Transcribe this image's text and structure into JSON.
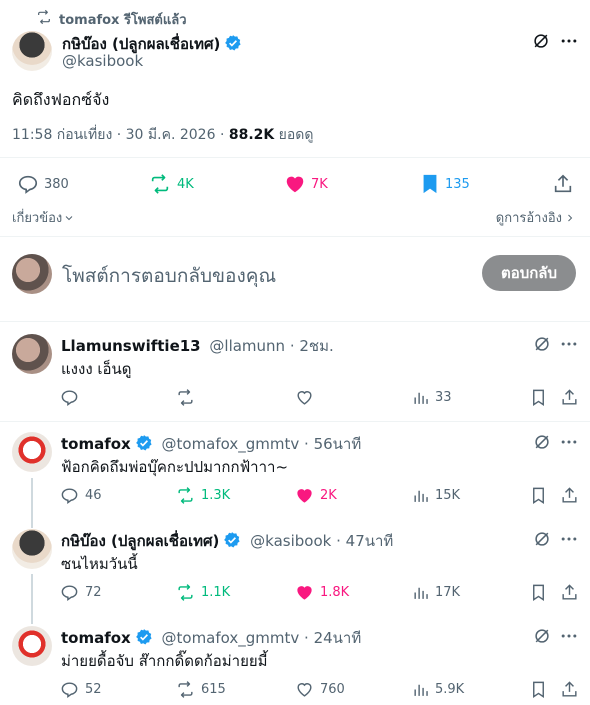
{
  "repost_banner": {
    "text": "tomafox รีโพสต์แล้ว"
  },
  "main_post": {
    "author_name": "กษิบ๊อง (ปลูกผลเชื่อเทศ)",
    "handle": "@kasibook",
    "text": "คิดถึงฟอกซ์จัง",
    "timestamp": "11:58 ก่อนเที่ยง · 30 มี.ค. 2026 · ",
    "views_value": "88.2K",
    "views_label": " ยอดดู",
    "stats": {
      "replies": "380",
      "reposts": "4K",
      "likes": "7K",
      "bookmarks": "135"
    },
    "related_label": "เกี่ยวข้อง",
    "quotes_label": "ดูการอ้างอิง"
  },
  "compose": {
    "placeholder": "โพสต์การตอบกลับของคุณ",
    "reply_button": "ตอบกลับ"
  },
  "replies": [
    {
      "name": "Llamunswiftie13",
      "handle": "@llamunn",
      "time": " · 2ชม.",
      "text": "แงงง เอ็นดู",
      "replies": "",
      "reposts": "",
      "likes": "",
      "views": "33"
    },
    {
      "name": "tomafox",
      "handle": "@tomafox_gmmtv",
      "time": " · 56นาที",
      "text": "ฟ้อกคิดถึมพ่อบุ๊คกะปปมากกฟ้าาา~",
      "replies": "46",
      "reposts": "1.3K",
      "likes": "2K",
      "views": "15K"
    },
    {
      "name": "กษิบ๊อง (ปลูกผลเชื่อเทศ)",
      "handle": "@kasibook",
      "time": " · 47นาที",
      "text": "ซนไหมวันนี้",
      "replies": "72",
      "reposts": "1.1K",
      "likes": "1.8K",
      "views": "17K"
    },
    {
      "name": "tomafox",
      "handle": "@tomafox_gmmtv",
      "time": " · 24นาที",
      "text": "ม่ายยดื้อจับ ส๊ากกดิ๊ดดก้อม่ายยมี้",
      "replies": "52",
      "reposts": "615",
      "likes": "760",
      "views": "5.9K"
    }
  ],
  "colors": {
    "verified": "#1d9bf0",
    "repost_active": "#00ba7c",
    "like_active": "#f91880",
    "bookmark_active": "#1d9bf0",
    "muted": "#536471"
  },
  "icons": [
    "repost-icon",
    "verified-badge-icon",
    "grok-icon",
    "more-icon",
    "reply-icon",
    "heart-icon",
    "bookmark-icon",
    "share-icon",
    "views-icon",
    "chevron-down-icon",
    "chevron-right-icon"
  ]
}
